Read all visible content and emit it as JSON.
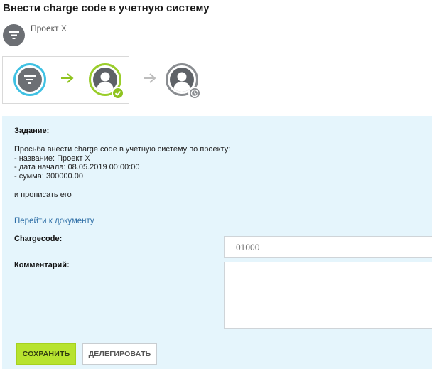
{
  "header": {
    "title": "Внести charge code в учетную систему",
    "project_icon": "filter-icon",
    "project_name": "Проект X"
  },
  "workflow": {
    "steps": [
      {
        "icon": "filter-icon",
        "state": "current",
        "color": "#3fc1e3"
      },
      {
        "icon": "user-avatar-icon",
        "state": "done",
        "color": "#9acd2b",
        "badge": "check-icon"
      },
      {
        "icon": "user-avatar-icon",
        "state": "pending",
        "color": "#8a8d91",
        "badge": "clock-icon"
      }
    ],
    "arrows": [
      {
        "icon": "arrow-right-icon",
        "color": "#8fc31f"
      },
      {
        "icon": "arrow-right-icon",
        "color": "#bdbdbd"
      }
    ]
  },
  "task": {
    "heading": "Задание:",
    "lines": [
      "Просьба внести charge code в учетную систему по проекту:",
      "- название: Проект X",
      "- дата начала: 08.05.2019 00:00:00",
      "- сумма: 300000.00"
    ],
    "extra": "и прописать его",
    "doc_link": "Перейти к документу",
    "background": "#e5f5fc"
  },
  "form": {
    "chargecode_label": "Chargecode:",
    "chargecode_placeholder": "01000",
    "comment_label": "Комментарий:",
    "comment_value": ""
  },
  "actions": {
    "save_label": "СОХРАНИТЬ",
    "delegate_label": "ДЕЛЕГИРОВАТЬ",
    "accent": "#b7e32f"
  }
}
